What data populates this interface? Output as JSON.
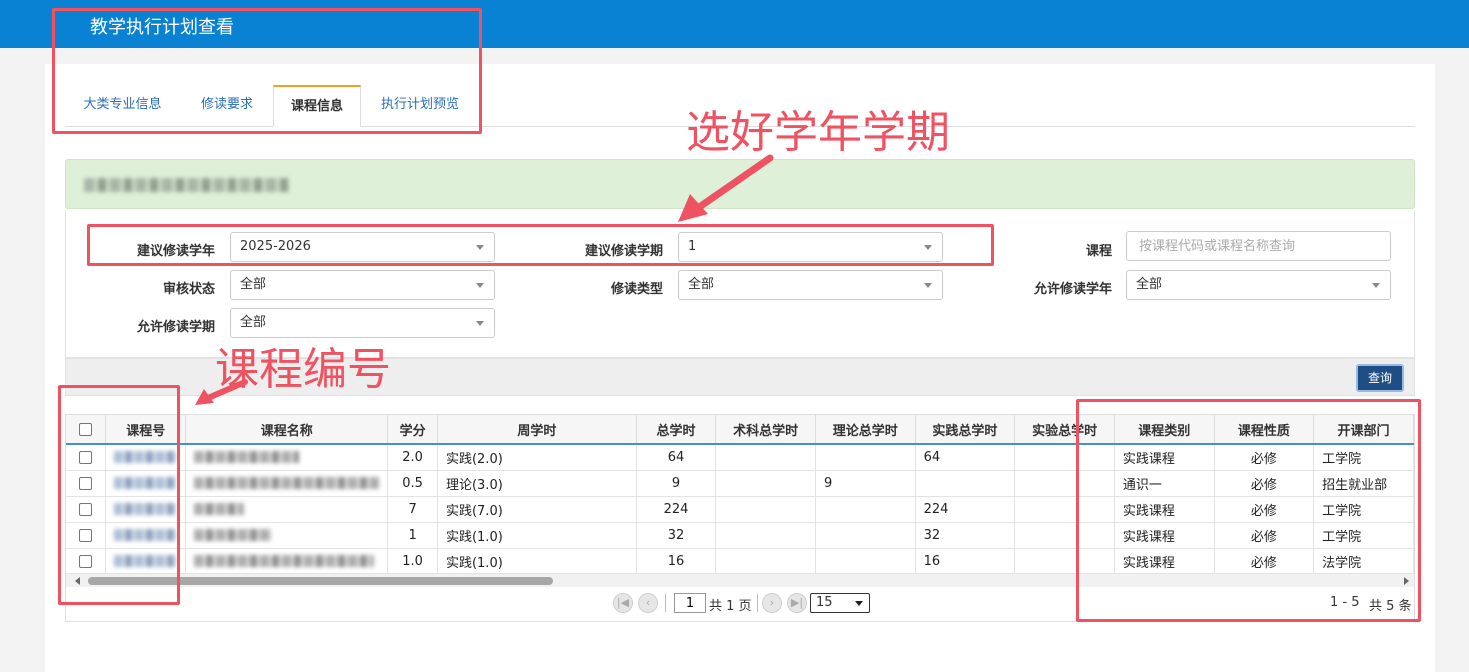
{
  "app": {
    "title": "教学执行计划查看"
  },
  "tabs": [
    {
      "label": "大类专业信息"
    },
    {
      "label": "修读要求"
    },
    {
      "label": "课程信息"
    },
    {
      "label": "执行计划预览"
    }
  ],
  "filters": {
    "suggest_year": {
      "label": "建议修读学年",
      "value": "2025-2026"
    },
    "suggest_term": {
      "label": "建议修读学期",
      "value": "1"
    },
    "course": {
      "label": "课程",
      "placeholder": "按课程代码或课程名称查询"
    },
    "audit_status": {
      "label": "审核状态",
      "value": "全部"
    },
    "study_type": {
      "label": "修读类型",
      "value": "全部"
    },
    "allow_year": {
      "label": "允许修读学年",
      "value": "全部"
    },
    "allow_term": {
      "label": "允许修读学期",
      "value": "全部"
    }
  },
  "toolbar": {
    "query_label": "查询"
  },
  "table": {
    "headers": [
      "课程号",
      "课程名称",
      "学分",
      "周学时",
      "总学时",
      "术科总学时",
      "理论总学时",
      "实践总学时",
      "实验总学时",
      "课程类别",
      "课程性质",
      "开课部门"
    ],
    "rows": [
      {
        "credit": "2.0",
        "weekly": "实践(2.0)",
        "total": "64",
        "sport": "",
        "theory": "",
        "practice": "64",
        "lab": "",
        "category": "实践课程",
        "nature": "必修",
        "dept": "工学院"
      },
      {
        "credit": "0.5",
        "weekly": "理论(3.0)",
        "total": "9",
        "sport": "",
        "theory": "9",
        "practice": "",
        "lab": "",
        "category": "通识一",
        "nature": "必修",
        "dept": "招生就业部"
      },
      {
        "credit": "7",
        "weekly": "实践(7.0)",
        "total": "224",
        "sport": "",
        "theory": "",
        "practice": "224",
        "lab": "",
        "category": "实践课程",
        "nature": "必修",
        "dept": "工学院"
      },
      {
        "credit": "1",
        "weekly": "实践(1.0)",
        "total": "32",
        "sport": "",
        "theory": "",
        "practice": "32",
        "lab": "",
        "category": "实践课程",
        "nature": "必修",
        "dept": "工学院"
      },
      {
        "credit": "1.0",
        "weekly": "实践(1.0)",
        "total": "16",
        "sport": "",
        "theory": "",
        "practice": "16",
        "lab": "",
        "category": "实践课程",
        "nature": "必修",
        "dept": "法学院"
      }
    ]
  },
  "pager": {
    "page": "1",
    "total_pages_text": "共 1 页",
    "page_size": "15",
    "range_text": "1 - 5",
    "total_text": "共 5 条"
  },
  "annotations": {
    "select_term": "选好学年学期",
    "course_code": "课程编号"
  },
  "colors": {
    "topbar": "#0a82d4",
    "annotation": "#ef5261",
    "info_bar": "#dff0d8",
    "query_button": "#1f4e86"
  }
}
